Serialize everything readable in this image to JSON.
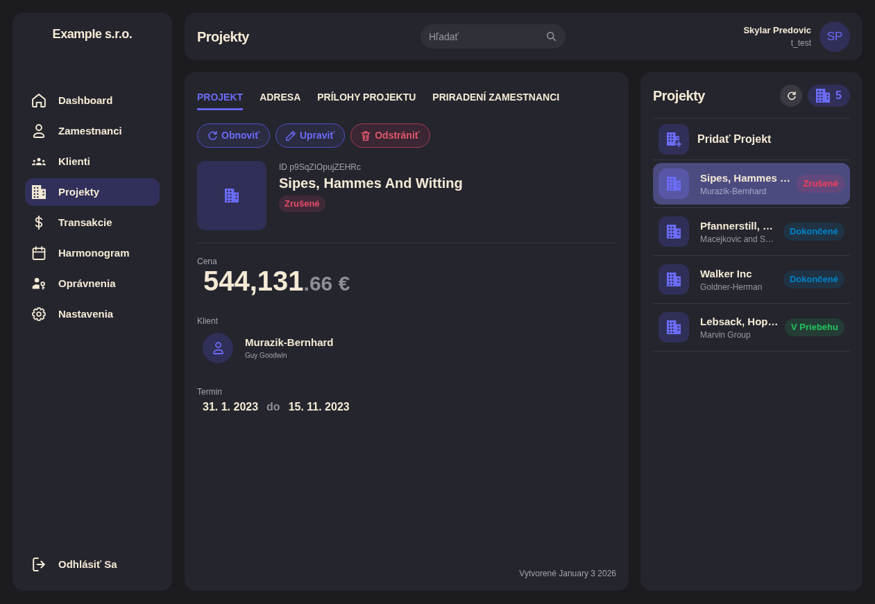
{
  "sidebar": {
    "logo": "Example s.r.o.",
    "items": [
      {
        "label": "Dashboard",
        "selected": false
      },
      {
        "label": "Zamestnanci",
        "selected": false
      },
      {
        "label": "Klienti",
        "selected": false
      },
      {
        "label": "Projekty",
        "selected": true
      },
      {
        "label": "Transakcie",
        "selected": false
      },
      {
        "label": "Harmonogram",
        "selected": false
      },
      {
        "label": "Oprávnenia",
        "selected": false
      },
      {
        "label": "Nastavenia",
        "selected": false
      }
    ],
    "logout": "Odhlásiť Sa"
  },
  "header": {
    "title": "Projekty",
    "search": {
      "placeholder": "Hľadať"
    },
    "user": {
      "name": "Skylar Predovic",
      "username": "t_test",
      "initials": "SP"
    }
  },
  "detail": {
    "tabs": [
      {
        "label": "PROJEKT",
        "selected": true
      },
      {
        "label": "ADRESA",
        "selected": false
      },
      {
        "label": "PRÍLOHY PROJEKTU",
        "selected": false
      },
      {
        "label": "PRIRADENÍ ZAMESTNANCI",
        "selected": false
      }
    ],
    "actions": [
      {
        "label": "Obnoviť",
        "kind": "refresh"
      },
      {
        "label": "Upraviť",
        "kind": "edit"
      },
      {
        "label": "Odstrániť",
        "kind": "delete"
      }
    ],
    "project": {
      "id": "ID p9SqZIOpujZEHRc",
      "name": "Sipes, Hammes And Witting",
      "status": {
        "label": "Zrušené",
        "color": "#e44b6b"
      }
    },
    "price": {
      "label": "Cena",
      "whole": "544,131",
      "fraction": ".66 €"
    },
    "client": {
      "label": "Klient",
      "name": "Murazik-Bernhard",
      "contact": "Guy Goodwin"
    },
    "term": {
      "label": "Termin",
      "start": "31. 1. 2023",
      "separator": "do",
      "end": "15. 11. 2023"
    },
    "created": "Vytvorené January 3 2026"
  },
  "projects_panel": {
    "title": "Projekty",
    "count": "5",
    "add_label": "Pridať Projekt",
    "items": [
      {
        "name": "Sipes, Hammes …",
        "client": "Murazik-Bernhard",
        "status": {
          "label": "Zrušené",
          "color": "#f43f5e"
        },
        "selected": true
      },
      {
        "name": "Pfannerstill, …",
        "client": "Macejkovic and S…",
        "status": {
          "label": "Dokončené",
          "color": "#0284c7"
        },
        "selected": false
      },
      {
        "name": "Walker Inc",
        "client": "Goldner-Herman",
        "status": {
          "label": "Dokončené",
          "color": "#0284c7"
        },
        "selected": false
      },
      {
        "name": "Lebsack, Hop…",
        "client": "Marvin Group",
        "status": {
          "label": "V Priebehu",
          "color": "#22c55e"
        },
        "selected": false
      }
    ]
  }
}
